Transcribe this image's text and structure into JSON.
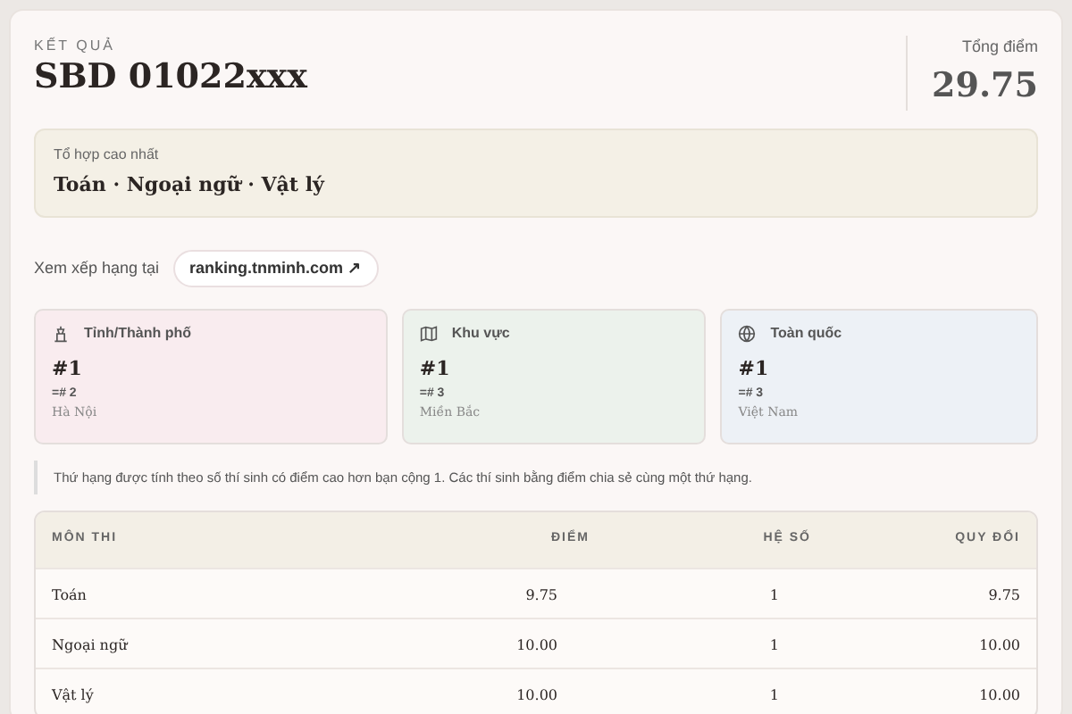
{
  "header": {
    "label": "KẾT QUẢ",
    "title": "SBD 01022xxx",
    "total_label": "Tổng điểm",
    "total": "29.75"
  },
  "combo": {
    "label": "Tổ hợp cao nhất",
    "value": "Toán · Ngoại ngữ · Vật lý"
  },
  "ranking_link": {
    "prefix": "Xem xếp hạng tại",
    "link": "ranking.tnminh.com",
    "arrow": "↗"
  },
  "ranks": [
    {
      "kind": "city",
      "title": "Tỉnh/Thành phố",
      "rank": "#1",
      "tie": "=# 2",
      "place": "Hà Nội",
      "color": "#f9ecef"
    },
    {
      "kind": "region",
      "title": "Khu vực",
      "rank": "#1",
      "tie": "=# 3",
      "place": "Miền Bắc",
      "color": "#ecf2ec"
    },
    {
      "kind": "nation",
      "title": "Toàn quốc",
      "rank": "#1",
      "tie": "=# 3",
      "place": "Việt Nam",
      "color": "#edf1f6"
    }
  ],
  "note": "Thứ hạng được tính theo số thí sinh có điểm cao hơn bạn cộng 1. Các thí sinh bằng điểm chia sẻ cùng một thứ hạng.",
  "table": {
    "columns": [
      "MÔN THI",
      "ĐIỂM",
      "HỆ SỐ",
      "QUY ĐỔI"
    ],
    "rows": [
      [
        "Toán",
        "9.75",
        "1",
        "9.75"
      ],
      [
        "Ngoại ngữ",
        "10.00",
        "1",
        "10.00"
      ],
      [
        "Vật lý",
        "10.00",
        "1",
        "10.00"
      ]
    ]
  }
}
